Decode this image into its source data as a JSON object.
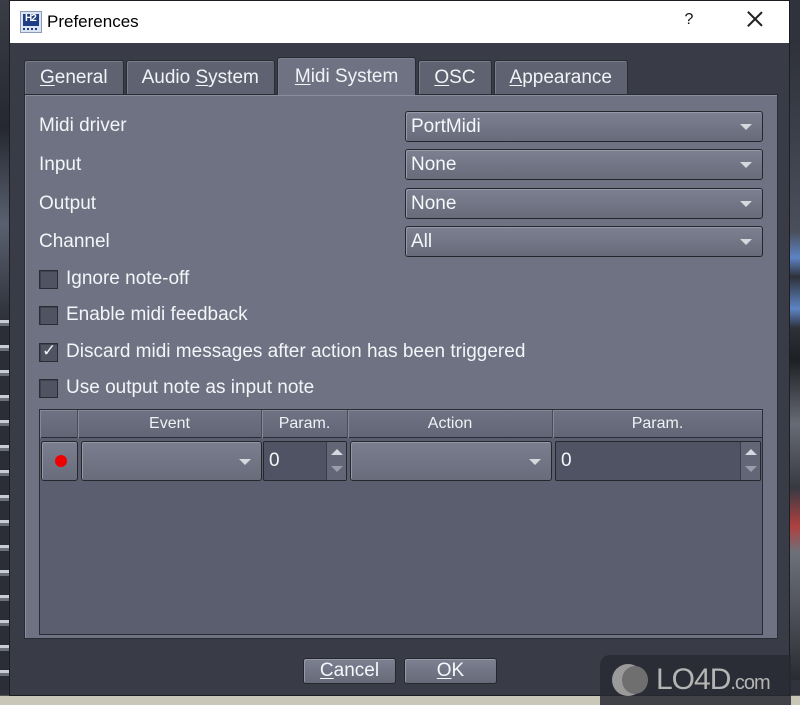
{
  "window": {
    "title": "Preferences",
    "app_icon": "hydrogen-logo-icon",
    "help_label": "?",
    "close_icon": "close-icon"
  },
  "tabs": [
    {
      "label": "General",
      "mnemonic": "G",
      "rest": "eneral",
      "active": false
    },
    {
      "label": "Audio System",
      "prefix": "Audio ",
      "mnemonic": "S",
      "rest": "ystem",
      "active": false
    },
    {
      "label": "Midi System",
      "mnemonic": "M",
      "rest": "idi System",
      "active": true
    },
    {
      "label": "OSC",
      "mnemonic": "O",
      "rest": "SC",
      "active": false
    },
    {
      "label": "Appearance",
      "mnemonic": "A",
      "rest": "ppearance",
      "active": false
    }
  ],
  "midi": {
    "driver": {
      "label": "Midi driver",
      "value": "PortMidi"
    },
    "input": {
      "label": "Input",
      "value": "None"
    },
    "output": {
      "label": "Output",
      "value": "None"
    },
    "channel": {
      "label": "Channel",
      "value": "All"
    }
  },
  "options": [
    {
      "label": "Ignore note-off",
      "checked": false
    },
    {
      "label": "Enable midi feedback",
      "checked": false
    },
    {
      "label": "Discard midi messages after action has been triggered",
      "checked": true
    },
    {
      "label": "Use output note as input note",
      "checked": false
    }
  ],
  "check_glyph": "✓",
  "table": {
    "headers": [
      "",
      "Event",
      "Param.",
      "Action",
      "Param."
    ],
    "rows": [
      {
        "record_color": "#ee0000",
        "event": "",
        "event_param": "0",
        "action": "",
        "action_param": "0"
      }
    ]
  },
  "buttons": {
    "cancel": {
      "label": "Cancel",
      "mnemonic": "C",
      "rest": "ancel"
    },
    "ok": {
      "label": "OK",
      "mnemonic": "O",
      "rest": "K"
    }
  },
  "watermark": {
    "brand": "LO4D",
    "suffix": ".com"
  }
}
